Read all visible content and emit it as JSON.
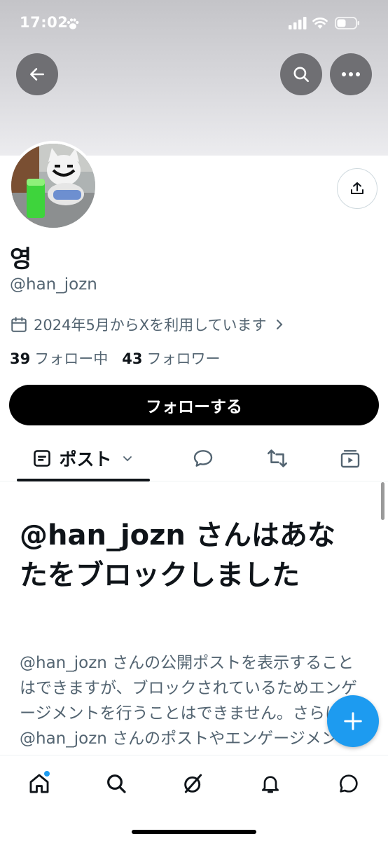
{
  "status_bar": {
    "time": "17:02"
  },
  "profile": {
    "display_name": "영",
    "handle": "@han_jozn",
    "joined": "2024年5月からXを利用しています",
    "following_count": "39",
    "following_label": "フォロー中",
    "followers_count": "43",
    "followers_label": "フォロワー",
    "follow_button": "フォローする"
  },
  "tabs": {
    "posts_label": "ポスト"
  },
  "blocked": {
    "title": "@han_jozn さんはあなたをブロックしました",
    "body": "@han_jozn さんの公開ポストを表示することはできますが、ブロックされているためエンゲージメントを行うことはできません。さらに、@han_jozn さんのポストやエンゲージメントが自分に表示されることはありません。"
  },
  "colors": {
    "accent": "#1d9bf0",
    "text": "#0f1419",
    "secondary": "#536471"
  },
  "icons": [
    "back-arrow-icon",
    "search-icon",
    "more-icon",
    "share-icon",
    "calendar-icon",
    "chevron-right-icon",
    "posts-icon",
    "chevron-down-icon",
    "reply-icon",
    "repost-icon",
    "media-icon",
    "plus-icon",
    "home-icon",
    "search-icon",
    "grok-icon",
    "bell-icon",
    "messages-icon"
  ]
}
